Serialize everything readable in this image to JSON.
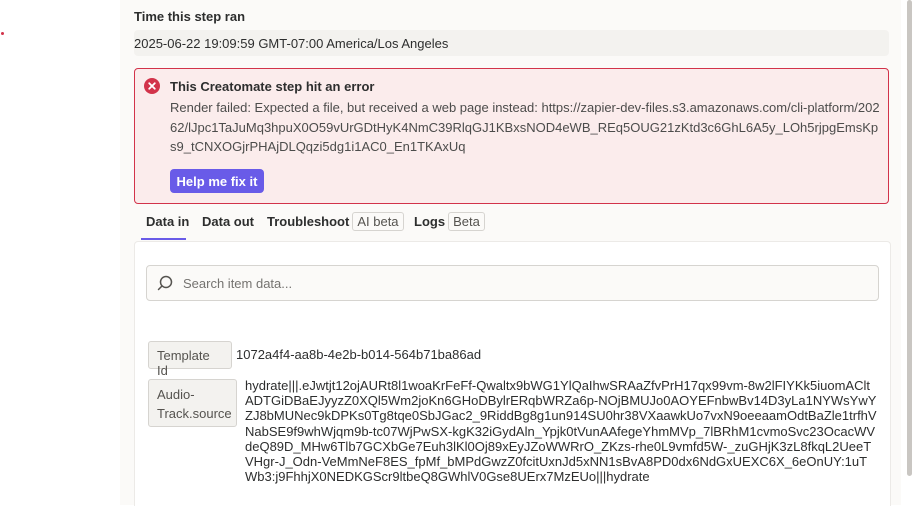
{
  "step": {
    "time_label": "Time this step ran",
    "time_value": "2025-06-22 19:09:59 GMT-07:00 America/Los Angeles"
  },
  "error": {
    "title": "This Creatomate step hit an error",
    "message": "Render failed: Expected a file, but received a web page instead: https://zapier-dev-files.s3.amazonaws.com/cli-platform/20262/lJpc1TaJuMq3hpuX0O59vUrGDtHyK4NmC39RlqGJ1KBxsNOD4eWB_REq5OUG21zKtd3c6GhL6A5y_LOh5rjpgEmsKps9_tCNXOGjrPHAjDLQqzi5dg1i1AC0_En1TKAxUq",
    "fix_button": "Help me fix it",
    "color": "#d2334a"
  },
  "tabs": [
    {
      "label": "Data in",
      "active": true
    },
    {
      "label": "Data out"
    },
    {
      "label": "Troubleshoot",
      "badge": "AI beta"
    },
    {
      "label": "Logs",
      "badge": "Beta"
    }
  ],
  "search": {
    "placeholder": "Search item data..."
  },
  "items": [
    {
      "key": "Template Id",
      "value": "1072a4f4-aa8b-4e2b-b014-564b71ba86ad"
    },
    {
      "key": "Audio-Track.source",
      "value": "hydrate|||.eJwtjt12ojAURt8l1woaKrFeFf-Qwaltx9bWG1YlQaIhwSRAaZfvPrH17qx99vm-8w2lFIYKk5iuomACltADTGiDBaEJyyzZ0XQl5Wm2joKn6GHoDBylrERqbWRZa6p-NOjBMUJo0AOYEFnbwBv14D3yLa1NYWsYwYZJ8bMUNec9kDPKs0Tg8tqe0SbJGac2_9RiddBg8g1un914SU0hr38VXaawkUo7vxN9oeeaamOdtBaZle1trfhVNabSE9f9whWjqm9b-tc07WjPwSX-kgK32iGydAln_Ypjk0tVunAAfegeYhmMVp_7lBRhM1cvmoSvc23OcacWVdeQ89D_MHw6Tlb7GCXbGe7Euh3lKl0Oj89xEyJZoWWRrO_ZKzs-rhe0L9vmfd5W-_zuGHjK3zL8fkqL2UeeTVHgr-J_Odn-VeMmNeF8ES_fpMf_bMPdGwzZ0fcitUxnJd5xNN1sBvA8PD0dx6NdGxUEXC6X_6eOnUY:1uTWb3:j9FhhjX0NEDKGScr9ltbeQ8GWhlV0Gse8UErx7MzEUo|||hydrate"
    }
  ],
  "icons": {
    "error": "error-circle-icon",
    "search": "search-icon"
  },
  "accent_color": "#695be8"
}
